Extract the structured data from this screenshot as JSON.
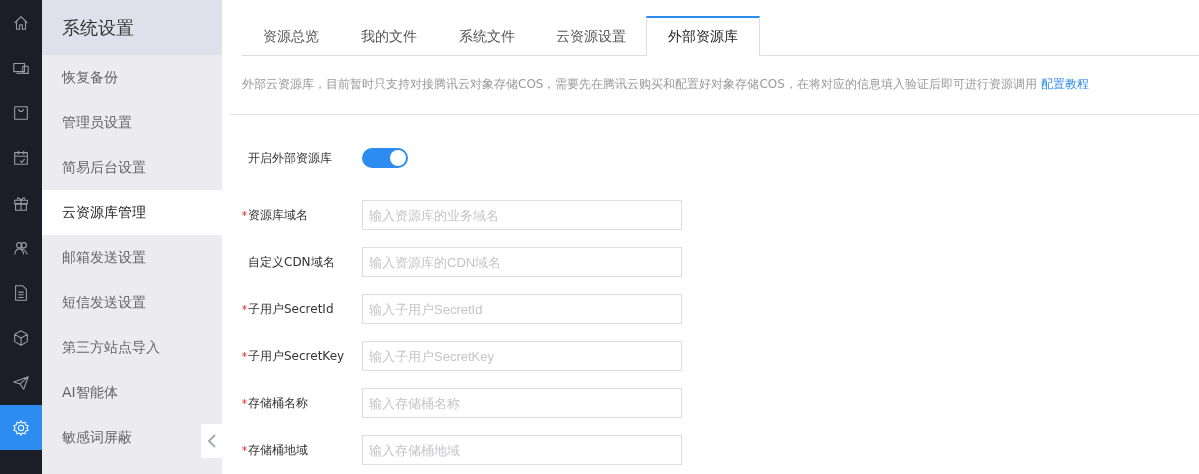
{
  "rail": {
    "items": [
      {
        "selected": false
      },
      {
        "selected": false
      },
      {
        "selected": false
      },
      {
        "selected": false
      },
      {
        "selected": false
      },
      {
        "selected": false
      },
      {
        "selected": false
      },
      {
        "selected": false
      },
      {
        "selected": false
      },
      {
        "selected": true
      }
    ]
  },
  "sidebar": {
    "title": "系统设置",
    "items": [
      {
        "label": "恢复备份",
        "selected": false
      },
      {
        "label": "管理员设置",
        "selected": false
      },
      {
        "label": "简易后台设置",
        "selected": false
      },
      {
        "label": "云资源库管理",
        "selected": true
      },
      {
        "label": "邮箱发送设置",
        "selected": false
      },
      {
        "label": "短信发送设置",
        "selected": false
      },
      {
        "label": "第三方站点导入",
        "selected": false
      },
      {
        "label": "AI智能体",
        "selected": false
      },
      {
        "label": "敏感词屏蔽",
        "selected": false
      }
    ]
  },
  "tabs": [
    {
      "label": "资源总览",
      "selected": false
    },
    {
      "label": "我的文件",
      "selected": false
    },
    {
      "label": "系统文件",
      "selected": false
    },
    {
      "label": "云资源设置",
      "selected": false
    },
    {
      "label": "外部资源库",
      "selected": true
    }
  ],
  "notice": {
    "text": "外部云资源库，目前暂时只支持对接腾讯云对象存储COS，需要先在腾讯云购买和配置好对象存储COS，在将对应的信息填入验证后即可进行资源调用",
    "link": "配置教程"
  },
  "form": {
    "fields": [
      {
        "kind": "toggle",
        "label": "开启外部资源库",
        "required": false,
        "on": true
      },
      {
        "kind": "text",
        "label": "资源库域名",
        "required": true,
        "placeholder": "输入资源库的业务域名"
      },
      {
        "kind": "text",
        "label": "自定义CDN域名",
        "required": false,
        "placeholder": "输入资源库的CDN域名"
      },
      {
        "kind": "text",
        "label": "子用户SecretId",
        "required": true,
        "placeholder": "输入子用户SecretId"
      },
      {
        "kind": "text",
        "label": "子用户SecretKey",
        "required": true,
        "placeholder": "输入子用户SecretKey"
      },
      {
        "kind": "text",
        "label": "存储桶名称",
        "required": true,
        "placeholder": "输入存储桶名称"
      },
      {
        "kind": "text",
        "label": "存储桶地域",
        "required": true,
        "placeholder": "输入存储桶地域"
      }
    ]
  }
}
